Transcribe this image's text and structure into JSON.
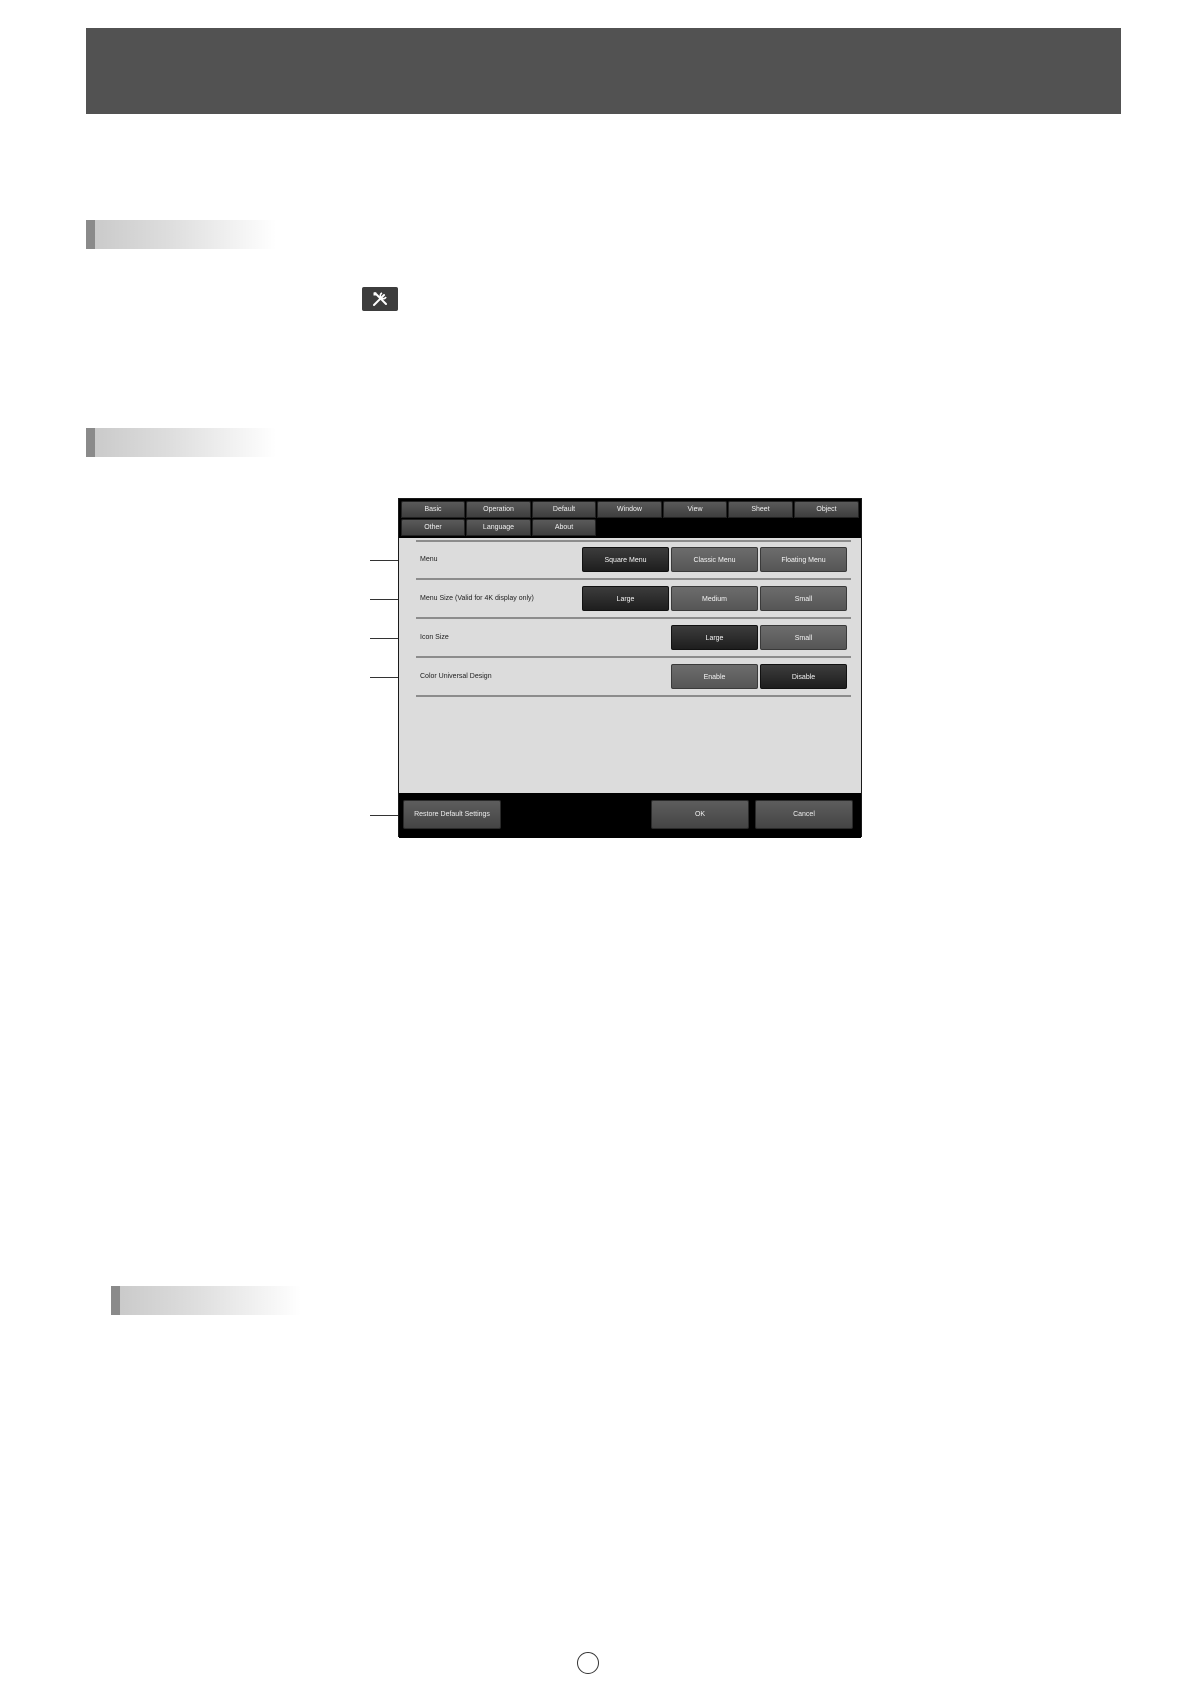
{
  "dialog": {
    "tabs_row1": [
      "Basic",
      "Operation",
      "Default",
      "Window",
      "View",
      "Sheet",
      "Object"
    ],
    "tabs_row2": [
      "Other",
      "Language",
      "About"
    ],
    "rows": [
      {
        "label": "Menu",
        "options": [
          "Square Menu",
          "Classic Menu",
          "Floating Menu"
        ],
        "selected": "Square Menu"
      },
      {
        "label": "Menu Size (Valid for 4K display only)",
        "options": [
          "Large",
          "Medium",
          "Small"
        ],
        "selected": "Large"
      },
      {
        "label": "Icon Size",
        "options": [
          "Large",
          "Small"
        ],
        "selected": "Large"
      },
      {
        "label": "Color Universal Design",
        "options": [
          "Enable",
          "Disable"
        ],
        "selected": "Disable"
      }
    ],
    "footer": {
      "restore_label": "Restore Default Settings",
      "ok_label": "OK",
      "cancel_label": "Cancel"
    }
  },
  "icons": {
    "settings": "tools-icon"
  },
  "colors": {
    "header_bar": "#525252",
    "selected_button": "#1e1e1e",
    "button": "#6c6c6c",
    "panel": "#dcdcdc"
  }
}
